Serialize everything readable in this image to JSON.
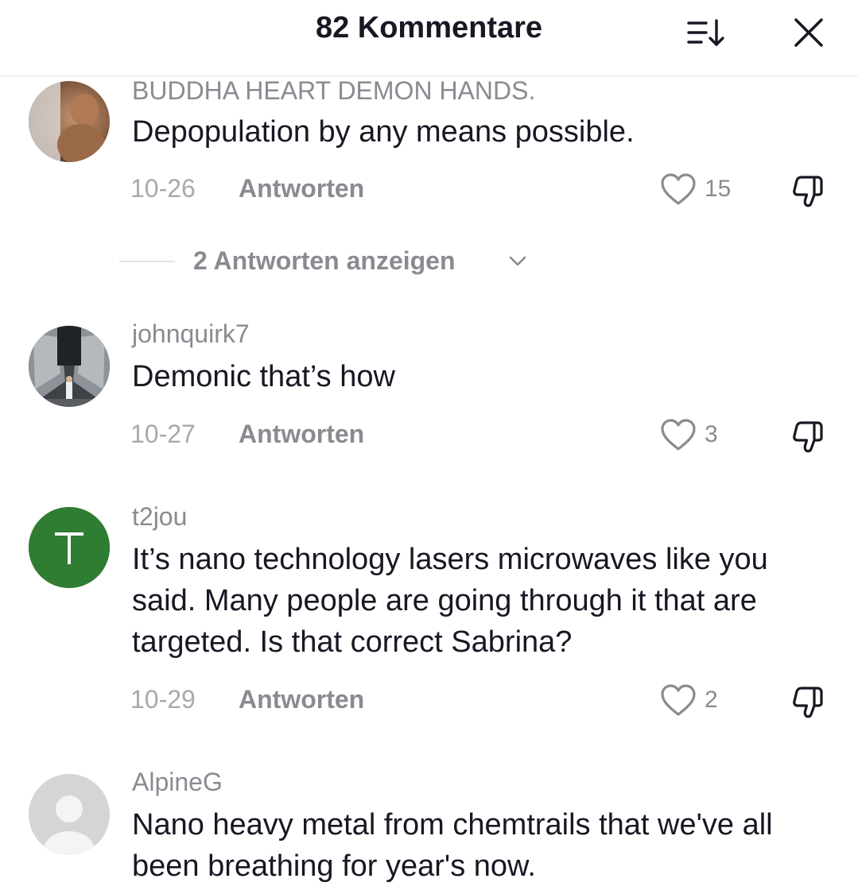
{
  "header": {
    "title": "82 Kommentare",
    "sort_icon": "sort-descending-icon",
    "close_icon": "close-icon"
  },
  "comments": [
    {
      "username": "BUDDHA HEART DEMON HANDS.",
      "text": "Depopulation by any means possible.",
      "date": "10-26",
      "reply_label": "Antworten",
      "likes": "15",
      "avatar": "photo"
    },
    {
      "username": "johnquirk7",
      "text": "Demonic that’s how",
      "date": "10-27",
      "reply_label": "Antworten",
      "likes": "3",
      "avatar": "photo"
    },
    {
      "username": "t2jou",
      "text": "It’s nano technology lasers microwaves like you said. Many people are going through it that are targeted. Is that correct Sabrina?",
      "date": "10-29",
      "reply_label": "Antworten",
      "likes": "2",
      "avatar_letter": "T",
      "avatar_color": "#2f7d32"
    },
    {
      "username": "AlpineG",
      "text": "Nano heavy metal from chemtrails that we've all been breathing for year's now.",
      "avatar": "default-person"
    }
  ],
  "view_replies": {
    "label": "2 Antworten anzeigen"
  },
  "colors": {
    "primary_text": "#161823",
    "secondary_text": "#8a8b91",
    "tertiary_text": "#a8a9ae",
    "divider": "#e6e6e6"
  }
}
